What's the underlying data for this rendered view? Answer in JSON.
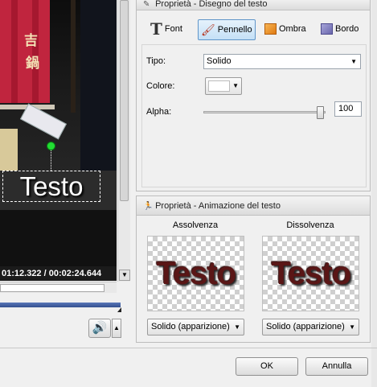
{
  "video": {
    "overlay_text": "Testo",
    "time_current": "01:12.322",
    "time_separator": "/",
    "time_total": "00:02:24.644"
  },
  "panel_text": {
    "title": "Proprietà - Disegno del testo",
    "tabs": [
      {
        "label": "Font",
        "icon": "font-icon"
      },
      {
        "label": "Pennello",
        "icon": "brush-icon",
        "active": true
      },
      {
        "label": "Ombra",
        "icon": "shadow-icon"
      },
      {
        "label": "Bordo",
        "icon": "border-icon"
      }
    ],
    "tipo_label": "Tipo:",
    "tipo_value": "Solido",
    "colore_label": "Colore:",
    "colore_value": "#ffffff",
    "alpha_label": "Alpha:",
    "alpha_value": "100"
  },
  "panel_anim": {
    "title": "Proprietà - Animazione del testo",
    "fade_in_label": "Assolvenza",
    "fade_out_label": "Dissolvenza",
    "preview_text": "Testo",
    "fade_in_value": "Solido (apparizione)",
    "fade_out_value": "Solido (apparizione)"
  },
  "buttons": {
    "ok": "OK",
    "cancel": "Annulla"
  }
}
